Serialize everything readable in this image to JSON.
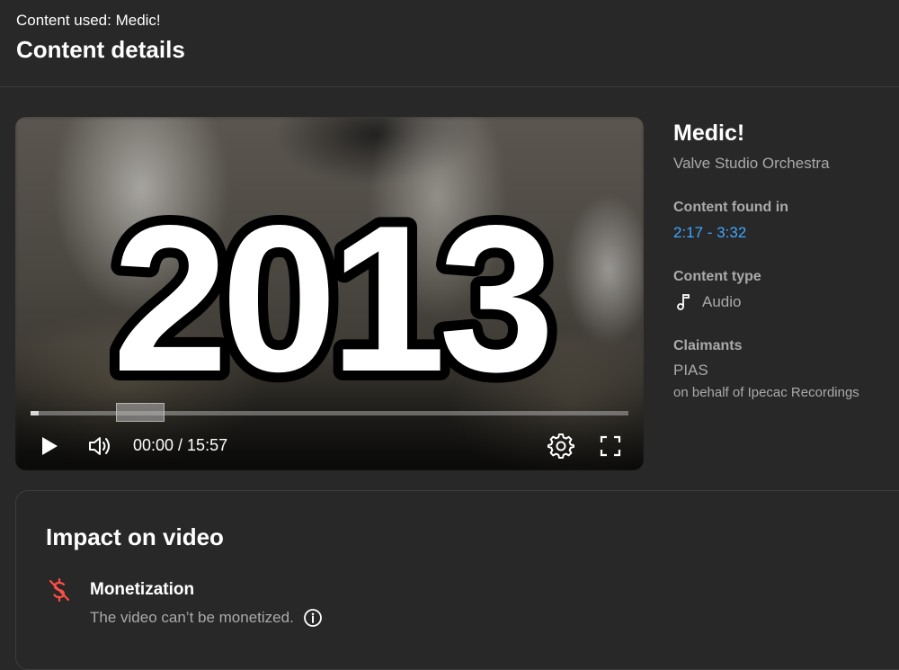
{
  "header": {
    "eyebrow": "Content used: Medic!",
    "title": "Content details"
  },
  "player": {
    "thumbnail_text": "2013",
    "time": "00:00 / 15:57",
    "progress": 0.0
  },
  "details": {
    "title": "Medic!",
    "artist": "Valve Studio Orchestra",
    "found_label": "Content found in",
    "found_range": "2:17 - 3:32",
    "type_label": "Content type",
    "type_value": "Audio",
    "claimants_label": "Claimants",
    "claimant": "PIAS",
    "on_behalf": "on behalf of Ipecac Recordings"
  },
  "impact": {
    "title": "Impact on video",
    "monetization_title": "Monetization",
    "monetization_desc": "The video can’t be monetized."
  },
  "colors": {
    "background": "#282828",
    "link": "#3ea6ff",
    "secondary_text": "#aaaaaa",
    "warning_icon": "#ff4e45"
  },
  "icons": [
    "play-icon",
    "volume-icon",
    "settings-gear-icon",
    "fullscreen-icon",
    "music-note-icon",
    "no-money-icon",
    "info-icon"
  ]
}
